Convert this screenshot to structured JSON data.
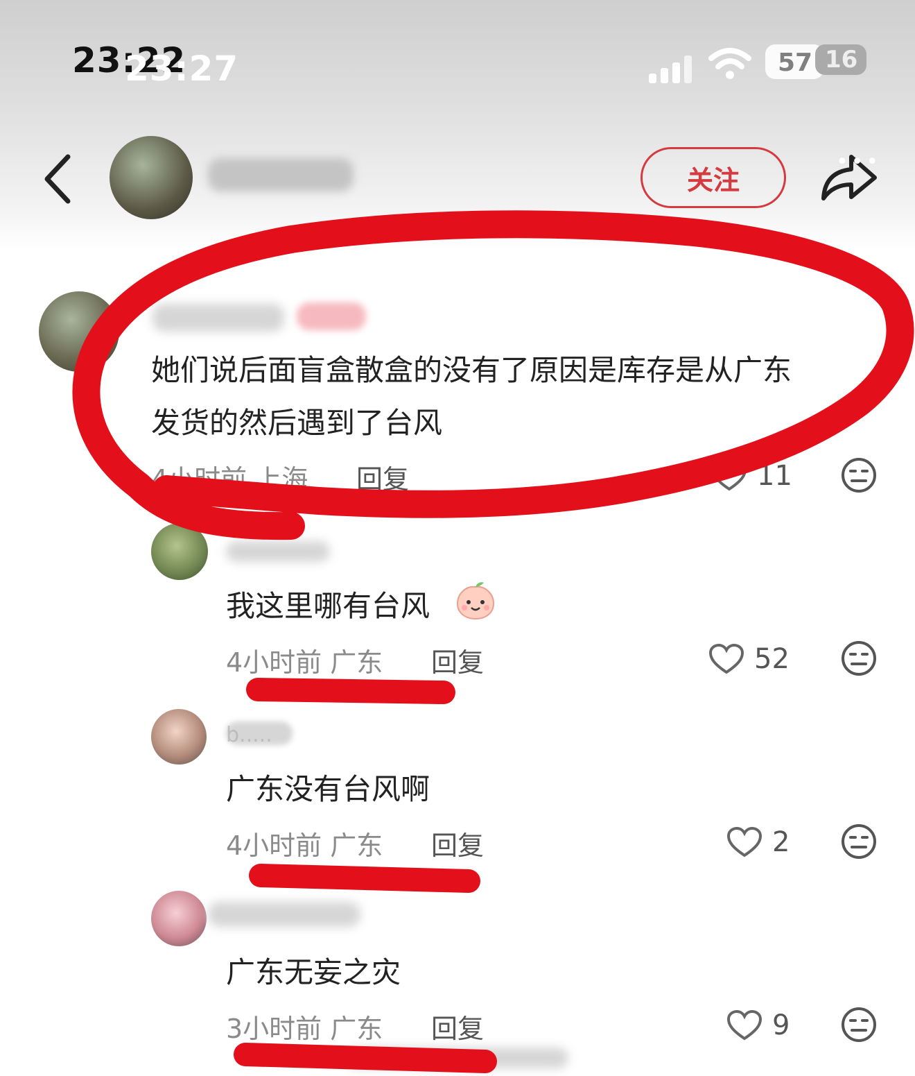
{
  "status_bar": {
    "time_back": "23:22",
    "time_front": "23:27",
    "battery_a": "57",
    "battery_b": "16",
    "icons": [
      "signal-icon",
      "wifi-icon",
      "battery-icon"
    ]
  },
  "header": {
    "back_icon": "chevron-left-icon",
    "follow_label": "关注",
    "share_icon": "share-arrow-icon",
    "more_icon": "more-dots-icon"
  },
  "comments": [
    {
      "text_line1": "她们说后面盲盒散盒的没有了原因是库存是从广东",
      "text_line2": "发货的然后遇到了台风",
      "time_location": "4小时前 上海",
      "reply_label": "回复",
      "likes": "11"
    },
    {
      "text": "我这里哪有台风",
      "emoji": "peach-face-emoji",
      "time_location": "4小时前 广东",
      "reply_label": "回复",
      "likes": "52"
    },
    {
      "username_partial": "b.....",
      "text": "广东没有台风啊",
      "time_location": "4小时前 广东",
      "reply_label": "回复",
      "likes": "2"
    },
    {
      "text": "广东无妄之灾",
      "time_location": "3小时前 广东",
      "reply_label": "回复",
      "likes": "9"
    }
  ],
  "colors": {
    "accent_red": "#d43a3f",
    "annotation_red": "#e3101c",
    "meta_gray": "#8a8a8a"
  }
}
